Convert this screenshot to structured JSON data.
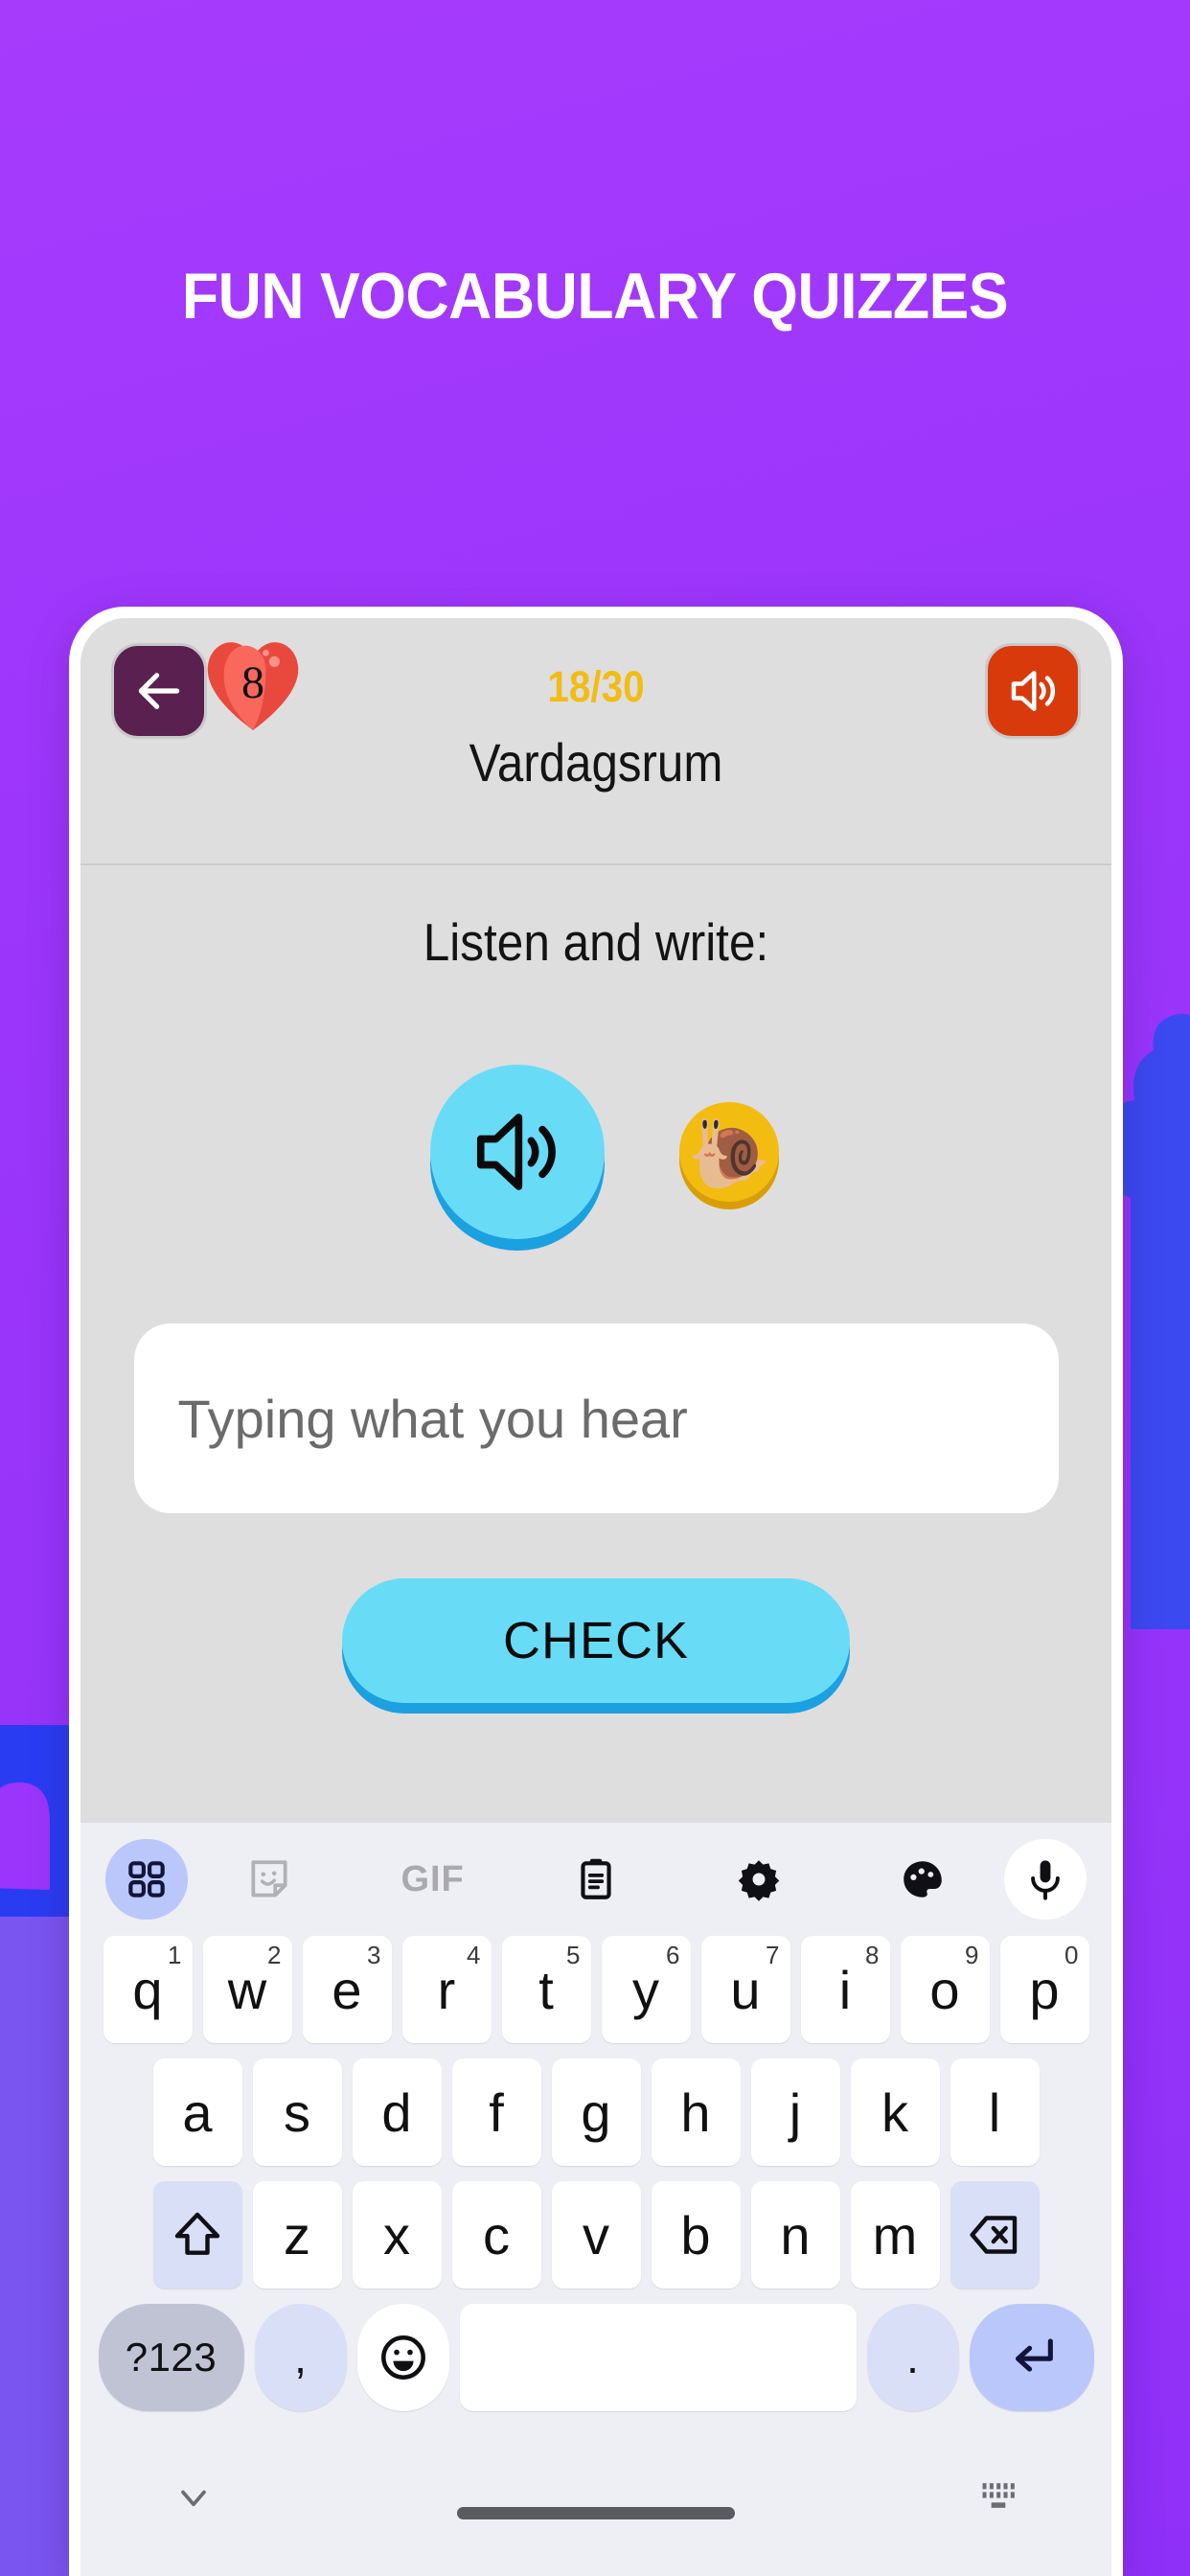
{
  "headline": "FUN VOCABULARY QUIZZES",
  "colors": {
    "background_purple": "#9b35fb",
    "deco_blue": "#3b49f0",
    "accent_cyan": "#68dcf7",
    "accent_cyan_shadow": "#1ba0e0",
    "progress_gold": "#f2bc14",
    "heart_red": "#f4594c",
    "back_button_purple": "#5a2150",
    "sound_button_orange": "#d93a0b",
    "snail_button_yellow": "#f2bc11",
    "caret_teal": "#127d70",
    "keyboard_bg": "#eeeef5",
    "key_white": "#ffffff",
    "key_fn_blue": "#d9dff6",
    "key_numeric_gray": "#bfc3d4",
    "key_enter_blue": "#b9c7fb",
    "app_bg_gray": "#dededf"
  },
  "app": {
    "header": {
      "back_icon": "arrow-left-icon",
      "hearts_count": "8",
      "heart_icon": "heart-icon",
      "progress": "18/30",
      "lesson_title": "Vardagsrum",
      "sound_icon": "speaker-on-icon"
    },
    "question": {
      "prompt": "Listen and write:",
      "play_normal_icon": "speaker-play-icon",
      "play_slow_icon": "snail-icon",
      "play_slow_glyph": "🐌",
      "input_value": "",
      "input_placeholder": "Typing what you hear",
      "check_label": "CHECK"
    }
  },
  "keyboard": {
    "toolbar": [
      {
        "name": "apps-grid-icon",
        "label": ""
      },
      {
        "name": "sticker-icon",
        "label": ""
      },
      {
        "name": "gif-icon",
        "label": "GIF"
      },
      {
        "name": "clipboard-icon",
        "label": ""
      },
      {
        "name": "gear-icon",
        "label": ""
      },
      {
        "name": "palette-icon",
        "label": ""
      },
      {
        "name": "microphone-icon",
        "label": ""
      }
    ],
    "row1": [
      {
        "key": "q",
        "num": "1"
      },
      {
        "key": "w",
        "num": "2"
      },
      {
        "key": "e",
        "num": "3"
      },
      {
        "key": "r",
        "num": "4"
      },
      {
        "key": "t",
        "num": "5"
      },
      {
        "key": "y",
        "num": "6"
      },
      {
        "key": "u",
        "num": "7"
      },
      {
        "key": "i",
        "num": "8"
      },
      {
        "key": "o",
        "num": "9"
      },
      {
        "key": "p",
        "num": "0"
      }
    ],
    "row2": [
      "a",
      "s",
      "d",
      "f",
      "g",
      "h",
      "j",
      "k",
      "l"
    ],
    "row3": [
      "z",
      "x",
      "c",
      "v",
      "b",
      "n",
      "m"
    ],
    "shift_icon": "shift-arrow-icon",
    "backspace_icon": "backspace-icon",
    "row4": {
      "numeric_label": "?123",
      "comma_label": ",",
      "emoji_icon": "emoji-smile-icon",
      "space_label": "",
      "period_label": ".",
      "enter_icon": "enter-return-icon"
    },
    "navbar": {
      "hide_icon": "chevron-down-icon",
      "home_indicator": "home-indicator",
      "switch_icon": "keyboard-switch-icon"
    }
  }
}
